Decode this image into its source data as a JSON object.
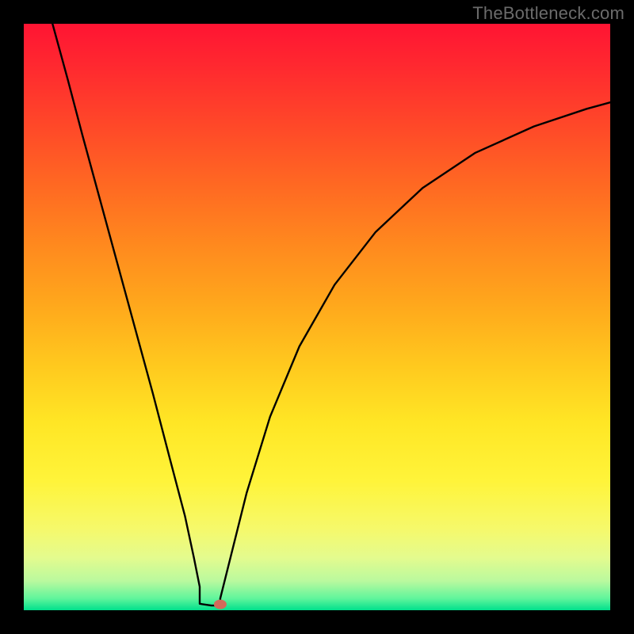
{
  "watermark": "TheBottleneck.com",
  "chart_data": {
    "type": "line",
    "title": "",
    "xlabel": "",
    "ylabel": "",
    "xlim": [
      0,
      1
    ],
    "ylim": [
      0,
      1
    ],
    "grid": false,
    "legend": false,
    "series": [
      {
        "name": "left-branch",
        "x": [
          0.049,
          0.075,
          0.1,
          0.13,
          0.16,
          0.19,
          0.22,
          0.25,
          0.275,
          0.29,
          0.3
        ],
        "y": [
          1.0,
          0.905,
          0.81,
          0.7,
          0.59,
          0.48,
          0.37,
          0.255,
          0.16,
          0.09,
          0.04
        ]
      },
      {
        "name": "vertex-flat",
        "x": [
          0.3,
          0.32,
          0.335
        ],
        "y": [
          0.011,
          0.008,
          0.008
        ]
      },
      {
        "name": "right-branch",
        "x": [
          0.335,
          0.35,
          0.38,
          0.42,
          0.47,
          0.53,
          0.6,
          0.68,
          0.77,
          0.87,
          0.96,
          1.0
        ],
        "y": [
          0.02,
          0.08,
          0.2,
          0.33,
          0.45,
          0.555,
          0.645,
          0.72,
          0.78,
          0.825,
          0.855,
          0.866
        ]
      }
    ],
    "marker": {
      "x": 0.335,
      "y": 0.01,
      "color": "#d36a5a"
    },
    "background_gradient": {
      "top": "#ff1433",
      "middle": "#ffe625",
      "bottom": "#00e08c"
    }
  }
}
